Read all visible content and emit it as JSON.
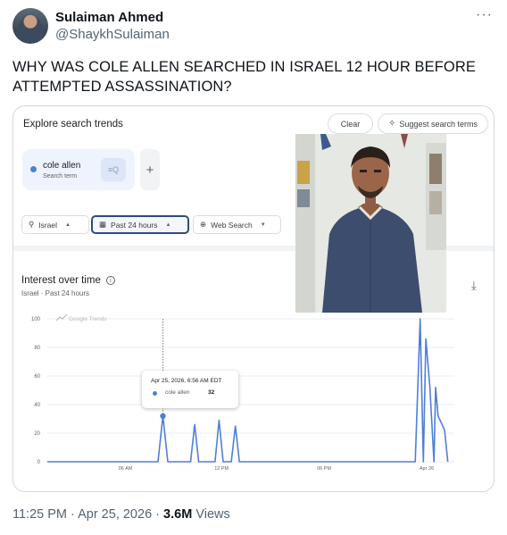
{
  "author": {
    "name": "Sulaiman Ahmed",
    "handle": "@ShaykhSulaiman",
    "more_icon": "more-horizontal-icon"
  },
  "tweet": {
    "text": "WHY WAS COLE ALLEN SEARCHED IN ISRAEL 12 HOUR BEFORE ATTEMPTED ASSASSINATION?",
    "time": "11:25 PM",
    "date": "Apr 25, 2026",
    "views_count": "3.6M",
    "views_label": "Views"
  },
  "trends": {
    "header_title": "Explore search trends",
    "clear_label": "Clear",
    "suggest_label": "Suggest search terms",
    "term": {
      "name": "cole allen",
      "subtitle": "Search term",
      "color": "#4f7fd6"
    },
    "add_label": "+",
    "filters": {
      "location": "Israel",
      "time_range": "Past 24 hours",
      "search_type": "Web Search"
    },
    "interest_title": "Interest over time",
    "interest_subtitle": "Israel · Past 24 hours",
    "watermark": "Google Trends",
    "tooltip": {
      "date": "Apr 25, 2026, 6:56 AM EDT",
      "term": "cole allen",
      "value": "32"
    }
  },
  "chart_data": {
    "type": "line",
    "series": [
      {
        "name": "cole allen",
        "color": "#4f7fd6",
        "points": [
          [
            0,
            0
          ],
          [
            68,
            0
          ],
          [
            71,
            32
          ],
          [
            74,
            0
          ],
          [
            88,
            0
          ],
          [
            90.5,
            26
          ],
          [
            93,
            0
          ],
          [
            103,
            0
          ],
          [
            105.5,
            29
          ],
          [
            108,
            0
          ],
          [
            113,
            0
          ],
          [
            115.5,
            25
          ],
          [
            118,
            0
          ],
          [
            226,
            0
          ],
          [
            229,
            100
          ],
          [
            231,
            0
          ],
          [
            232.5,
            86
          ],
          [
            235,
            52
          ],
          [
            237.5,
            0
          ],
          [
            238.5,
            52
          ],
          [
            240,
            32
          ],
          [
            242.5,
            26
          ],
          [
            244,
            22
          ],
          [
            246,
            0
          ]
        ]
      }
    ],
    "x_ticks": [
      {
        "value": 48,
        "label": "06 AM"
      },
      {
        "value": 107,
        "label": "12 PM"
      },
      {
        "value": 170,
        "label": "06 PM"
      },
      {
        "value": 233,
        "label": "Apr 26"
      }
    ],
    "xlim": [
      0,
      250
    ],
    "ylim": [
      0,
      100
    ],
    "y_ticks": [
      0,
      20,
      40,
      60,
      80,
      100
    ],
    "highlight": {
      "x": 71,
      "y": 32
    },
    "grid": true
  }
}
